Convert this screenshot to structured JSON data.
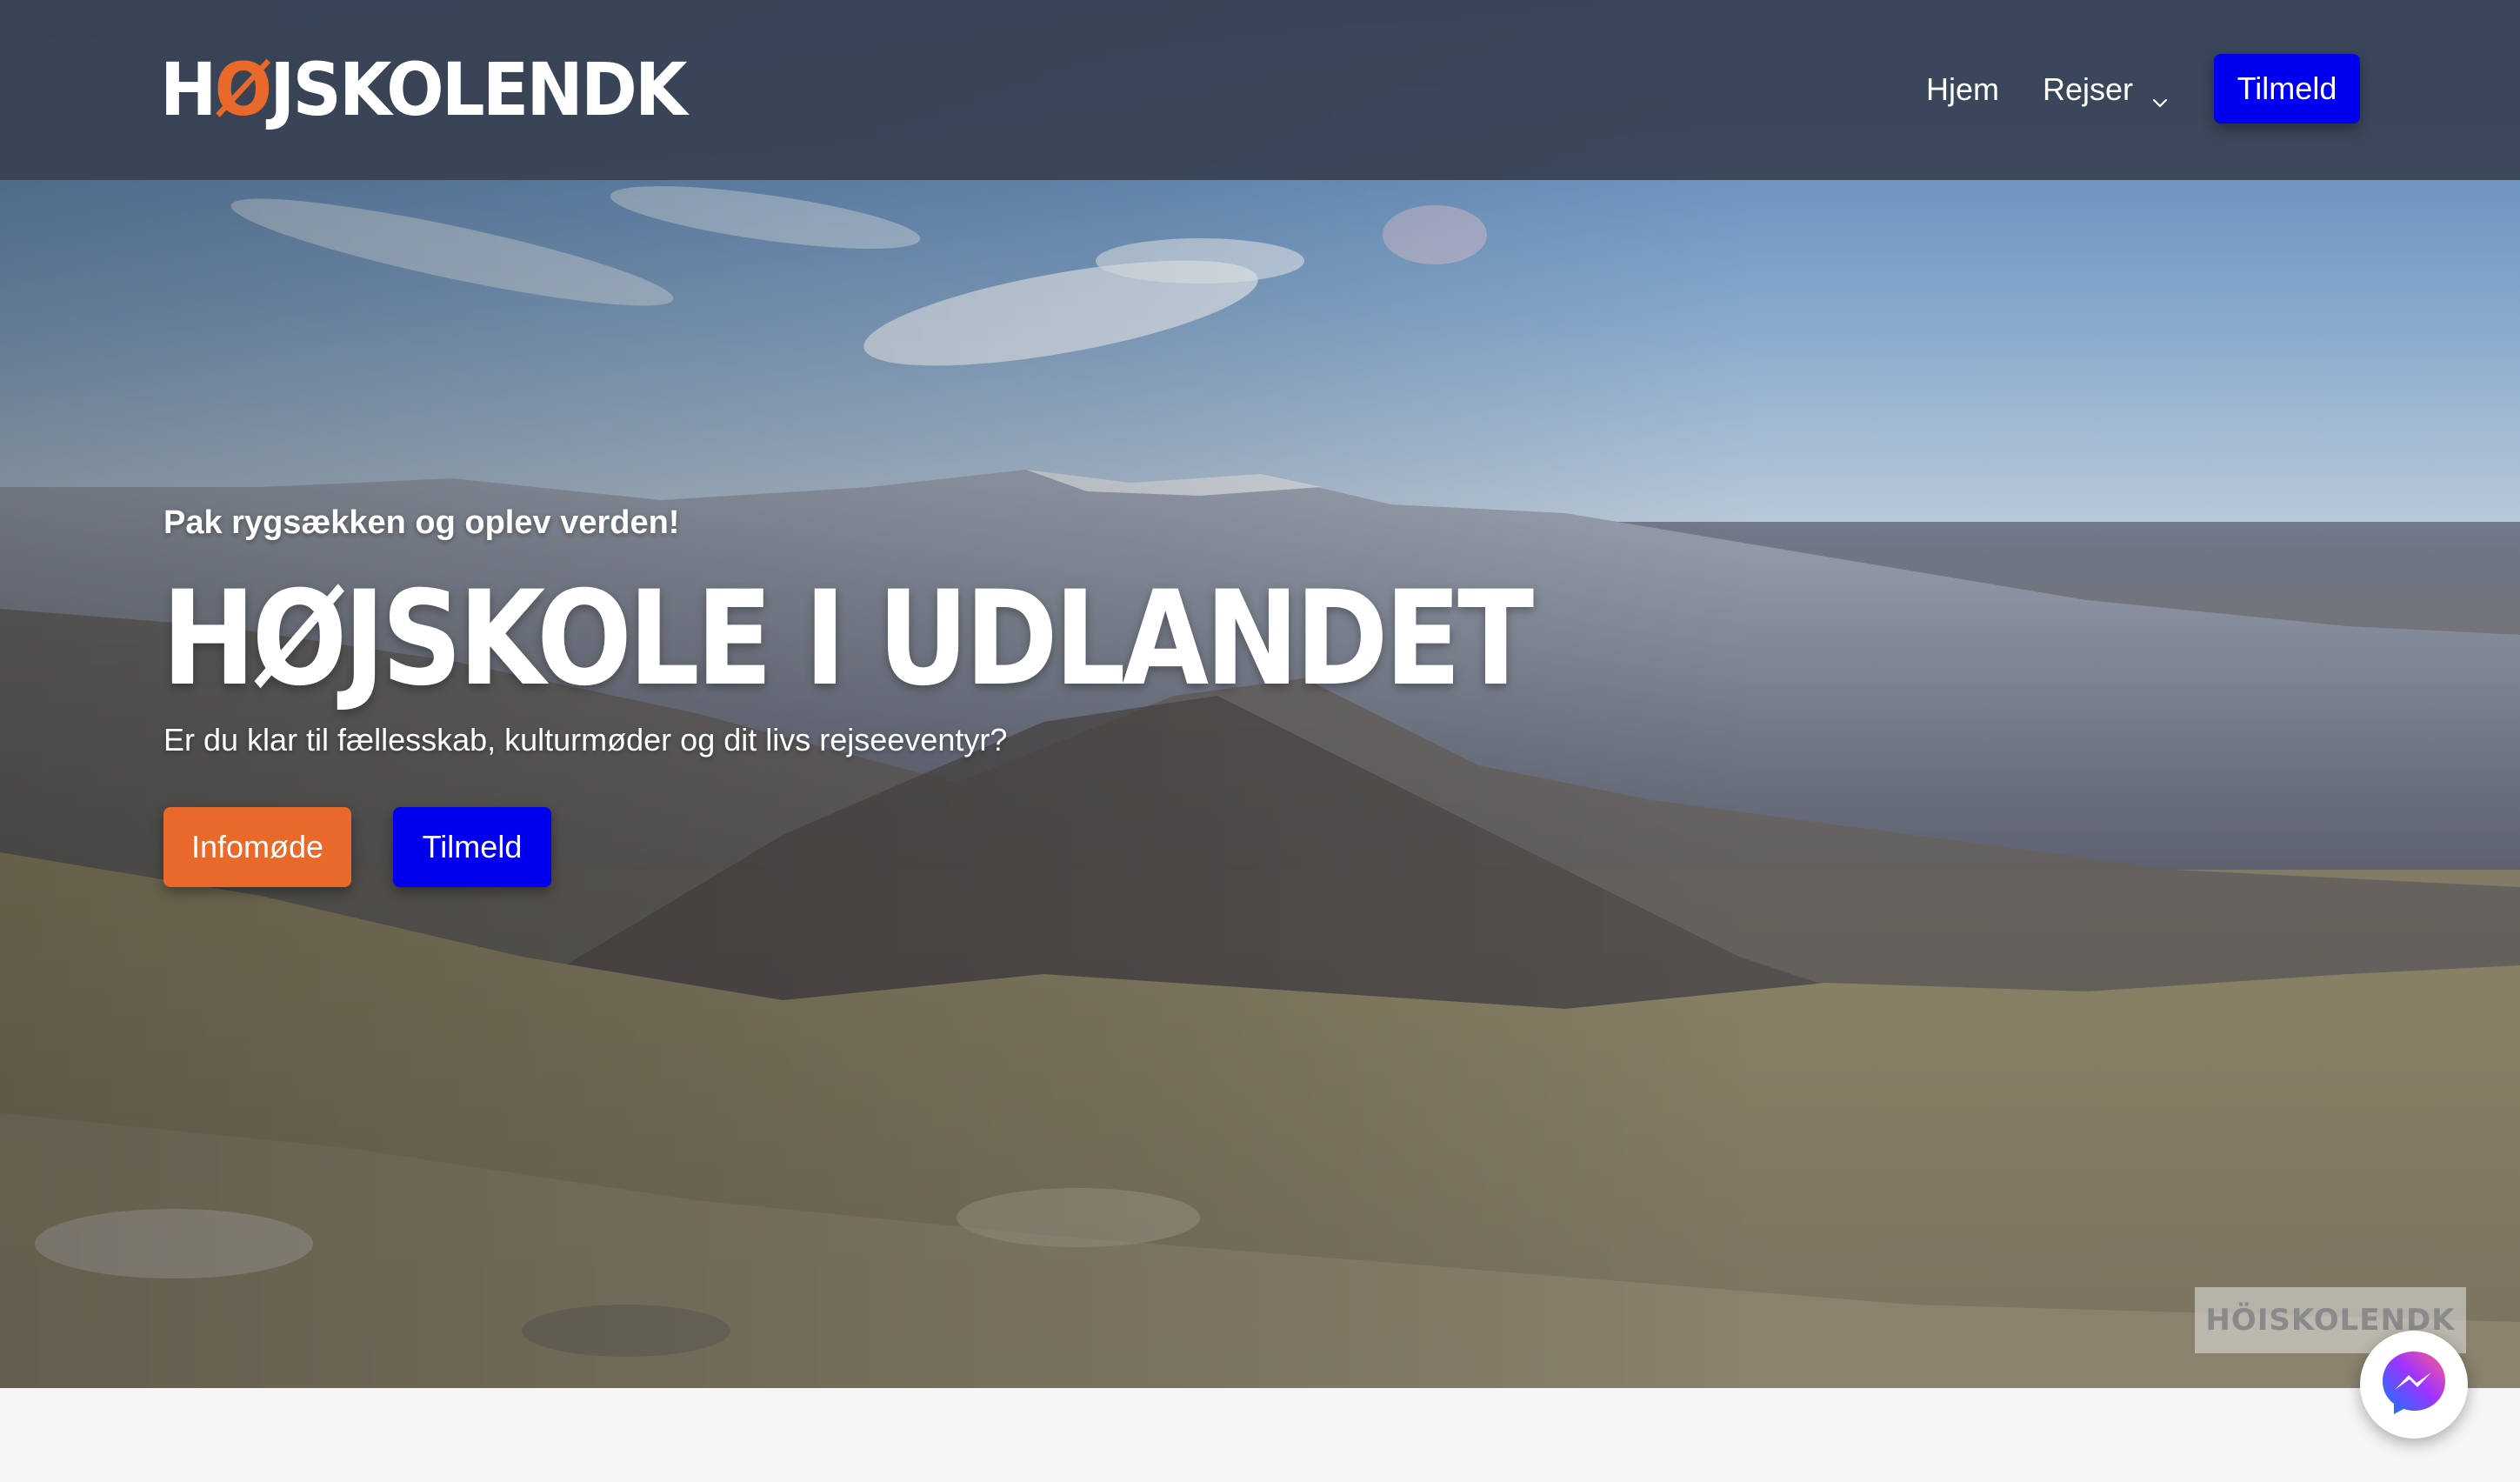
{
  "brand": {
    "logo_left": "H",
    "logo_o": "Ø",
    "logo_right": "JSKOLENDK",
    "accent_color": "#e8692a",
    "primary_button_color": "#0000ee"
  },
  "nav": {
    "home": "Hjem",
    "trips": "Rejser",
    "signup": "Tilmeld"
  },
  "hero": {
    "kicker": "Pak rygsækken og oplev verden!",
    "title": "HØJSKOLE I UDLANDET",
    "subtitle": "Er du klar til fællesskab, kulturmøder og dit livs rejseeventyr?",
    "cta_info": "Infomøde",
    "cta_signup": "Tilmeld",
    "watermark": "HÖISKOLENDK"
  },
  "icons": {
    "trips_dropdown": "chevron-down-icon",
    "chat": "messenger-icon"
  }
}
